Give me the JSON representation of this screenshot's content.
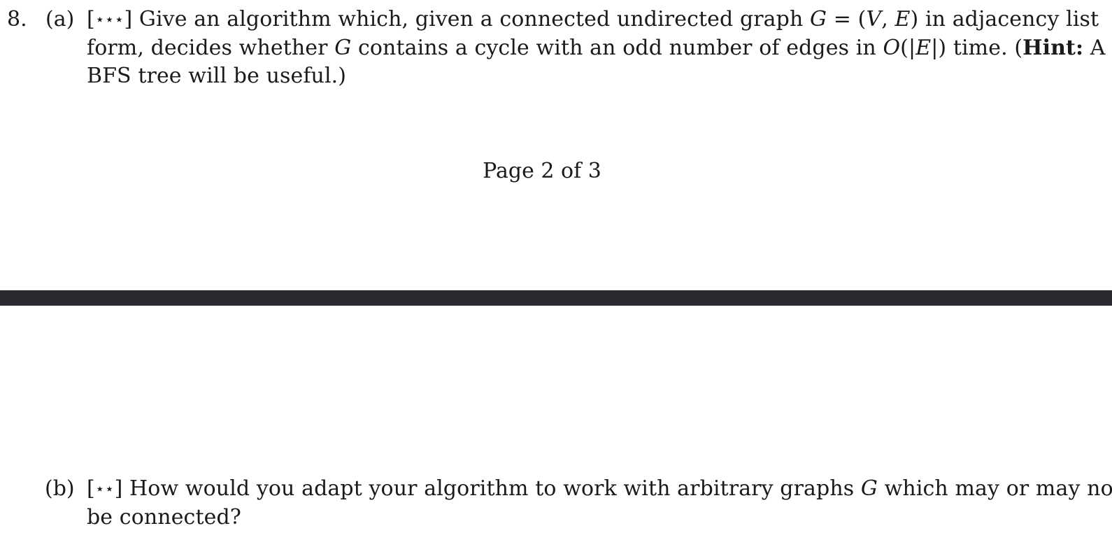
{
  "question": {
    "number": "8.",
    "part_a": {
      "label": "(a)",
      "stars": "⋆⋆⋆",
      "line1": {
        "lead": "Give an algorithm which, given a connected undirected graph",
        "g": "G",
        "eq": "= (",
        "v": "V",
        "comma": ",",
        "e": "E",
        "tail": ") in adjacency list"
      },
      "line2": {
        "lead": "form, decides whether",
        "g": "G",
        "mid": "contains a cycle with an odd number of edges in",
        "o": "O",
        "paren_open": "(|",
        "e": "E",
        "paren_close": "|) time. (",
        "hint": "Hint:",
        "tail": "A"
      },
      "line3": "BFS tree will be useful.)"
    },
    "part_b": {
      "label": "(b)",
      "stars": "⋆⋆",
      "line1": {
        "lead": "How would you adapt your algorithm to work with arbitrary graphs",
        "g": "G",
        "tail": "which may or may not"
      },
      "line2": "be connected?"
    }
  },
  "footer": {
    "page_text": "Page 2 of 3"
  },
  "colors": {
    "page_background": "#ffffff",
    "page_gap": "#2b2a30",
    "text": "#1a1a1a"
  }
}
